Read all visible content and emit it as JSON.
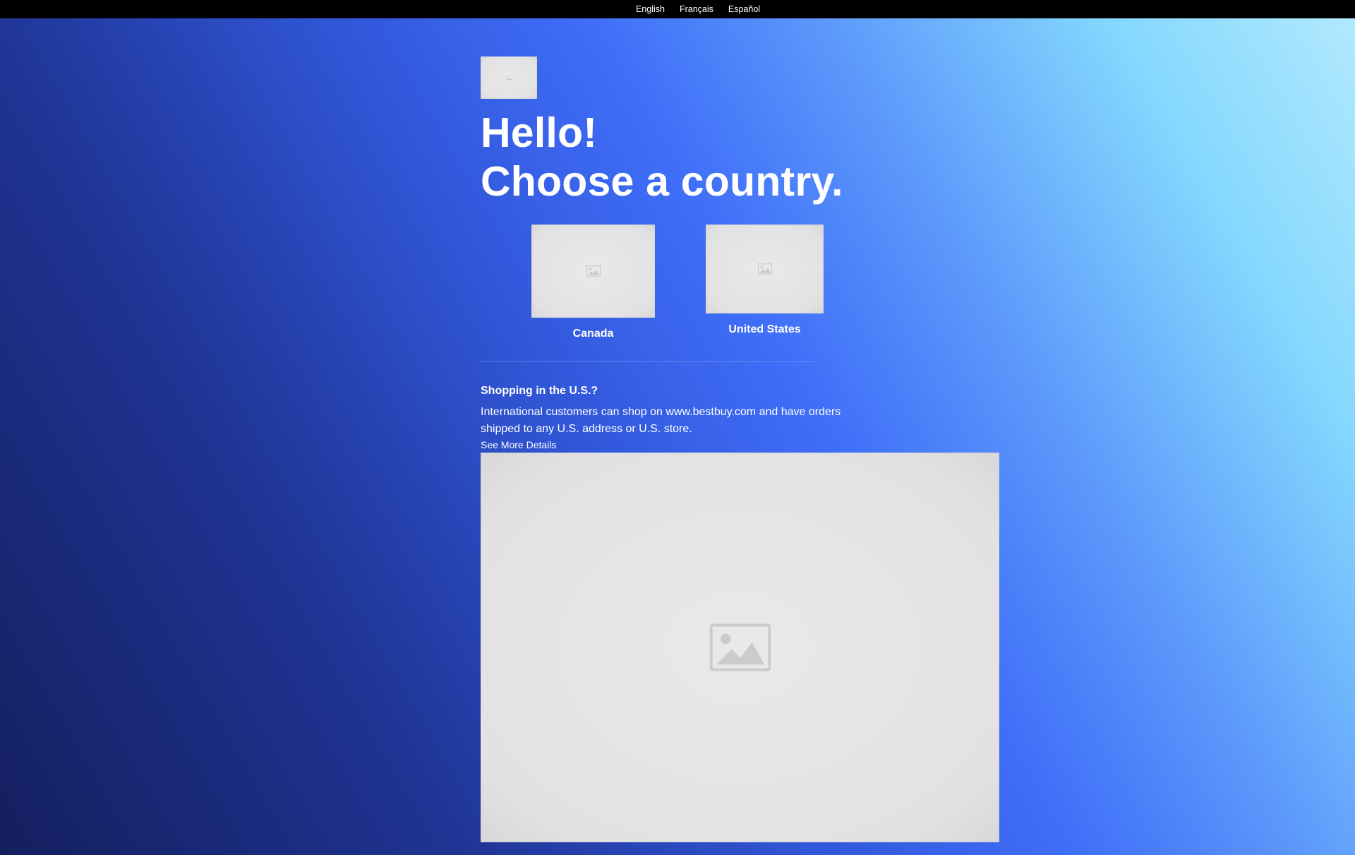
{
  "top_bar": {
    "languages": [
      "English",
      "Français",
      "Español"
    ]
  },
  "logo": {
    "icon": "image-placeholder-icon"
  },
  "hero": {
    "line1": "Hello!",
    "line2": "Choose a country."
  },
  "countries": [
    {
      "label": "Canada",
      "icon": "image-placeholder-icon"
    },
    {
      "label": "United States",
      "icon": "image-placeholder-icon"
    }
  ],
  "shopping_info": {
    "heading": "Shopping in the U.S.?",
    "body": "International customers can shop on www.bestbuy.com and have orders shipped to any U.S. address or U.S. store.",
    "link": "See More Details"
  },
  "banner": {
    "icon": "image-placeholder-icon"
  },
  "colors": {
    "top_bar": "#000000",
    "text": "#ffffff",
    "placeholder": "#e3e3e3",
    "gradient_dark": "#141f5e",
    "gradient_mid": "#3f6ef8",
    "gradient_light": "#b3eafe"
  }
}
